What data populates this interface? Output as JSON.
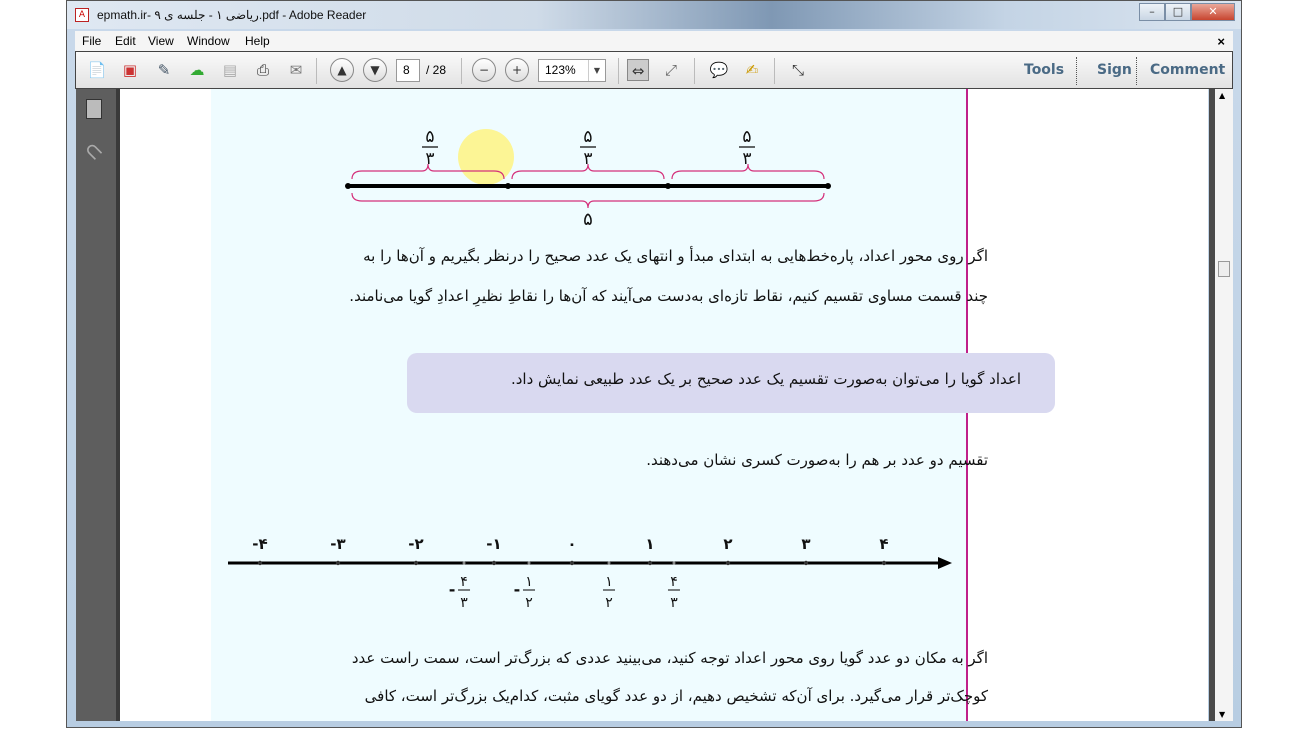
{
  "window": {
    "title": "epmath.ir- ریاضی ۱ - جلسه ی ۹.pdf - Adobe Reader",
    "minimize": "–",
    "maximize": "□",
    "close": "✕"
  },
  "menu": [
    "File",
    "Edit",
    "View",
    "Window",
    "Help"
  ],
  "menu_close": "×",
  "toolbar": {
    "page_current": "8",
    "page_total": "/ 28",
    "zoom": "123%",
    "tools": "Tools",
    "sign": "Sign",
    "comment": "Comment"
  },
  "diagram1": {
    "top_labels": [
      {
        "num": "۵",
        "den": "۳"
      },
      {
        "num": "۵",
        "den": "۳"
      },
      {
        "num": "۵",
        "den": "۳"
      }
    ],
    "bottom_label": "۵"
  },
  "paragraph1": [
    "اگر روی محور اعداد، پاره‌خط‌هایی به ابتدای مبدأ و انتهای یک عدد صحیح را درنظر بگیریم و آن‌ها را به",
    "چند قسمت مساوی تقسیم کنیم، نقاط تازه‌ای به‌دست می‌آیند که آن‌ها را نقاطِ نظیرِ اعدادِ گویا می‌نامند."
  ],
  "highlight_box": "اعداد گویا را می‌توان به‌صورت تقسیم یک عدد صحیح بر یک عدد طبیعی نمایش داد.",
  "paragraph2": "تقسیم دو عدد بر هم را به‌صورت کسری نشان می‌دهند.",
  "numberline": {
    "integers": [
      "-۴",
      "-۳",
      "-۲",
      "-۱",
      "۰",
      "۱",
      "۲",
      "۳",
      "۴"
    ],
    "integer_values": [
      -4,
      -3,
      -2,
      -1,
      0,
      1,
      2,
      3,
      4
    ],
    "fractions": [
      {
        "sign": "-",
        "num": "۴",
        "den": "۳",
        "value": -1.333
      },
      {
        "sign": "-",
        "num": "۱",
        "den": "۲",
        "value": -0.5
      },
      {
        "sign": "",
        "num": "۱",
        "den": "۲",
        "value": 0.5
      },
      {
        "sign": "",
        "num": "۴",
        "den": "۳",
        "value": 1.333
      }
    ]
  },
  "paragraph3": [
    "اگر به مکان دو عدد گویا روی محور اعداد توجه کنید، می‌بینید عددی که بزرگ‌تر است، سمت راست عدد",
    "کوچک‌تر قرار می‌گیرد. برای آن‌که تشخیص دهیم، از دو عدد گویای مثبت، کدام‌یک بزرگ‌تر است، کافی"
  ]
}
